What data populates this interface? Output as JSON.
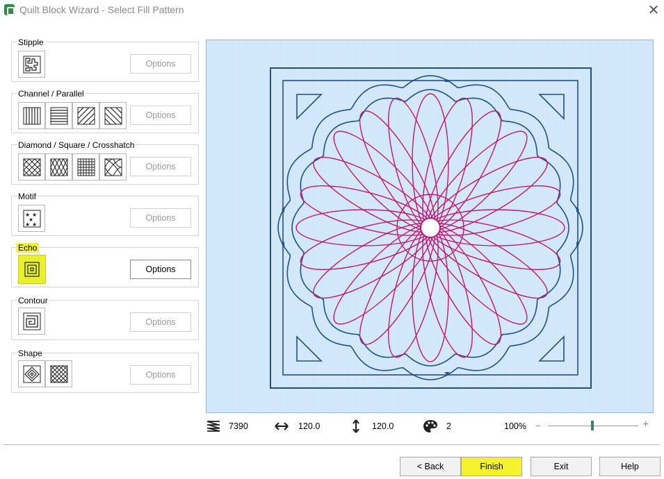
{
  "window": {
    "title": "Quilt Block Wizard - Select Fill Pattern",
    "close_icon": "close-icon"
  },
  "groups": {
    "stipple": {
      "label": "Stipple",
      "options_label": "Options",
      "tiles": [
        "stipple-pattern-icon"
      ]
    },
    "channel": {
      "label": "Channel / Parallel",
      "options_label": "Options",
      "tiles": [
        "vertical-lines-icon",
        "horizontal-lines-icon",
        "diagonal-lines-right-icon",
        "diagonal-lines-left-icon"
      ]
    },
    "diamond": {
      "label": "Diamond / Square / Crosshatch",
      "options_label": "Options",
      "tiles": [
        "diamond-crosshatch-icon",
        "diamond-tall-icon",
        "square-grid-icon",
        "curved-crosshatch-icon"
      ]
    },
    "motif": {
      "label": "Motif",
      "options_label": "Options",
      "tiles": [
        "stars-motif-icon"
      ]
    },
    "echo": {
      "label": "Echo",
      "options_label": "Options",
      "tiles": [
        "echo-squares-icon"
      ],
      "selected": true
    },
    "contour": {
      "label": "Contour",
      "options_label": "Options",
      "tiles": [
        "contour-spiral-icon"
      ]
    },
    "shape": {
      "label": "Shape",
      "options_label": "Options",
      "tiles": [
        "shape-diamond-icon",
        "shape-grid-icon"
      ]
    }
  },
  "status": {
    "stitch_count": "7390",
    "width": "120.0",
    "height": "120.0",
    "colors": "2",
    "zoom": "100%",
    "zoom_minus": "−",
    "zoom_plus": "+"
  },
  "footer": {
    "back_label": "< Back",
    "finish_label": "Finish",
    "exit_label": "Exit",
    "help_label": "Help"
  },
  "colors": {
    "highlight": "#f4f32e",
    "outline_blue": "#1f4f8c",
    "fill_magenta": "#c8146e",
    "preview_bg": "#cde6fb"
  }
}
